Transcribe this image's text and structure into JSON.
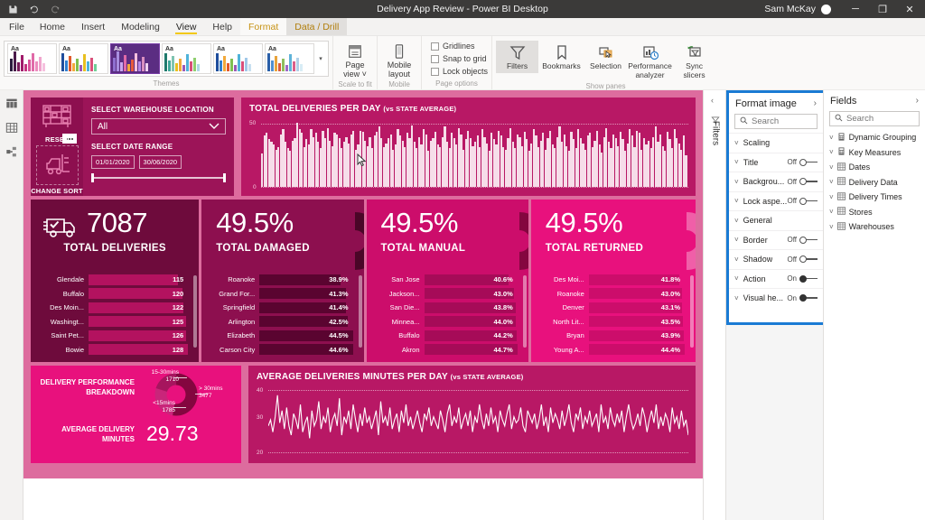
{
  "titlebar": {
    "save_icon": "save-icon",
    "undo_icon": "undo-icon",
    "redo_icon": "redo-icon",
    "title": "Delivery App Review - Power BI Desktop",
    "user": "Sam McKay",
    "minimize": "─",
    "restore": "❐",
    "close": "✕"
  },
  "ribbon_tabs": [
    {
      "label": "File",
      "state": "normal"
    },
    {
      "label": "Home",
      "state": "normal"
    },
    {
      "label": "Insert",
      "state": "normal"
    },
    {
      "label": "Modeling",
      "state": "normal"
    },
    {
      "label": "View",
      "state": "active"
    },
    {
      "label": "Help",
      "state": "normal"
    },
    {
      "label": "Format",
      "state": "contextual"
    },
    {
      "label": "Data / Drill",
      "state": "contextual-selected"
    }
  ],
  "ribbon": {
    "themes": {
      "group_label": "Themes",
      "swatch_text": "Aa",
      "selected_index": 2,
      "more_glyph": "▾"
    },
    "scale_to_fit": {
      "group_label": "Scale to fit",
      "button": {
        "line1": "Page",
        "line2": "view ˅",
        "icon": "page-view-icon"
      }
    },
    "mobile": {
      "group_label": "Mobile",
      "button": {
        "line1": "Mobile",
        "line2": "layout",
        "icon": "mobile-layout-icon"
      }
    },
    "page_options": {
      "group_label": "Page options",
      "checkboxes": [
        {
          "label": "Gridlines",
          "checked": false
        },
        {
          "label": "Snap to grid",
          "checked": false
        },
        {
          "label": "Lock objects",
          "checked": false
        }
      ]
    },
    "show_panes": {
      "group_label": "Show panes",
      "buttons": [
        {
          "line1": "Filters",
          "line2": "",
          "icon": "funnel-icon",
          "selected": true
        },
        {
          "line1": "Bookmarks",
          "line2": "",
          "icon": "bookmark-icon",
          "selected": false
        },
        {
          "line1": "Selection",
          "line2": "",
          "icon": "selection-icon",
          "selected": false
        },
        {
          "line1": "Performance",
          "line2": "analyzer",
          "icon": "performance-analyzer-icon",
          "selected": false
        },
        {
          "line1": "Sync",
          "line2": "slicers",
          "icon": "sync-slicers-icon",
          "selected": false
        }
      ]
    }
  },
  "left_rail": [
    {
      "name": "report-view-icon",
      "active": true
    },
    {
      "name": "data-view-icon",
      "active": false
    },
    {
      "name": "model-view-icon",
      "active": false
    }
  ],
  "report": {
    "controls": {
      "reset_label": "RESET",
      "change_sort_label": "CHANGE SORT",
      "warehouse_title": "SELECT WAREHOUSE LOCATION",
      "warehouse_value": "All",
      "date_title": "SELECT DATE RANGE",
      "date_start": "01/01/2020",
      "date_end": "30/06/2020"
    },
    "deliveries_chart": {
      "title": "TOTAL DELIVERIES PER DAY",
      "subtitle": "(vs STATE AVERAGE)",
      "y_max_label": "50",
      "y_min_label": "0"
    },
    "minutes_chart": {
      "title": "AVERAGE DELIVERIES MINUTES PER DAY",
      "subtitle": "(vs STATE AVERAGE)",
      "y_top_label": "40",
      "y_mid_label": "30",
      "y_bot_label": "20"
    },
    "kpis": [
      {
        "value": "7087",
        "label": "TOTAL DELIVERIES",
        "icon": "truck-check-icon",
        "has_gauge": false,
        "rows": [
          {
            "name": "Glendale",
            "value": "115",
            "pct": 90
          },
          {
            "name": "Buffalo",
            "value": "120",
            "pct": 94
          },
          {
            "name": "Des Moin...",
            "value": "122",
            "pct": 95
          },
          {
            "name": "Washingt...",
            "value": "125",
            "pct": 98
          },
          {
            "name": "Saint Pet...",
            "value": "126",
            "pct": 98
          },
          {
            "name": "Bowie",
            "value": "128",
            "pct": 100
          }
        ]
      },
      {
        "value": "49.5%",
        "label": "TOTAL DAMAGED",
        "has_gauge": true,
        "rows": [
          {
            "name": "Roanoke",
            "value": "38.9%",
            "pct": 87
          },
          {
            "name": "Grand For...",
            "value": "41.3%",
            "pct": 93
          },
          {
            "name": "Springfield",
            "value": "41.4%",
            "pct": 93
          },
          {
            "name": "Arlington",
            "value": "42.5%",
            "pct": 95
          },
          {
            "name": "Elizabeth",
            "value": "44.5%",
            "pct": 100
          },
          {
            "name": "Carson City",
            "value": "44.6%",
            "pct": 100
          }
        ]
      },
      {
        "value": "49.5%",
        "label": "TOTAL MANUAL",
        "has_gauge": true,
        "rows": [
          {
            "name": "San Jose",
            "value": "40.6%",
            "pct": 91
          },
          {
            "name": "Jackson...",
            "value": "43.0%",
            "pct": 96
          },
          {
            "name": "San Die...",
            "value": "43.8%",
            "pct": 98
          },
          {
            "name": "Minnea...",
            "value": "44.0%",
            "pct": 98
          },
          {
            "name": "Buffalo",
            "value": "44.2%",
            "pct": 99
          },
          {
            "name": "Akron",
            "value": "44.7%",
            "pct": 100
          }
        ]
      },
      {
        "value": "49.5%",
        "label": "TOTAL RETURNED",
        "has_gauge": true,
        "rows": [
          {
            "name": "Des Moi...",
            "value": "41.8%",
            "pct": 94
          },
          {
            "name": "Roanoke",
            "value": "43.0%",
            "pct": 97
          },
          {
            "name": "Denver",
            "value": "43.1%",
            "pct": 97
          },
          {
            "name": "North Lit...",
            "value": "43.5%",
            "pct": 98
          },
          {
            "name": "Bryan",
            "value": "43.9%",
            "pct": 99
          },
          {
            "name": "Young A...",
            "value": "44.4%",
            "pct": 100
          }
        ]
      }
    ],
    "performance": {
      "title_line1": "DELIVERY PERFORMANCE",
      "title_line2": "BREAKDOWN",
      "avg_label_line1": "AVERAGE DELIVERY",
      "avg_label_line2": "MINUTES",
      "avg_value": "29.73",
      "segments": [
        {
          "label": "15-30mins",
          "value": "1710"
        },
        {
          "label": "> 30mins",
          "value": "3477"
        },
        {
          "label": "<15mins",
          "value": "1785"
        }
      ]
    }
  },
  "filters_strip": {
    "label": "Filters",
    "collapse_glyph": "‹",
    "icon": "funnel-icon"
  },
  "format_pane": {
    "title": "Format image",
    "expand_glyph": "›",
    "search_placeholder": "Search",
    "rows": [
      {
        "name": "Scaling",
        "toggle": null
      },
      {
        "name": "Title",
        "toggle": "Off"
      },
      {
        "name": "Backgrou...",
        "toggle": "Off"
      },
      {
        "name": "Lock aspe...",
        "toggle": "Off"
      },
      {
        "name": "General",
        "toggle": null
      },
      {
        "name": "Border",
        "toggle": "Off"
      },
      {
        "name": "Shadow",
        "toggle": "Off"
      },
      {
        "name": "Action",
        "toggle": "On"
      },
      {
        "name": "Visual he...",
        "toggle": "On"
      }
    ]
  },
  "fields_pane": {
    "title": "Fields",
    "expand_glyph": "›",
    "search_placeholder": "Search",
    "items": [
      {
        "label": "Dynamic Grouping",
        "icon": "calculator-icon"
      },
      {
        "label": "Key Measures",
        "icon": "calculator-icon"
      },
      {
        "label": "Dates",
        "icon": "table-icon"
      },
      {
        "label": "Delivery Data",
        "icon": "table-icon"
      },
      {
        "label": "Delivery Times",
        "icon": "table-icon"
      },
      {
        "label": "Stores",
        "icon": "table-icon"
      },
      {
        "label": "Warehouses",
        "icon": "table-icon"
      }
    ]
  },
  "chart_data": [
    {
      "type": "bar",
      "title": "TOTAL DELIVERIES PER DAY (vs STATE AVERAGE)",
      "ylabel": "",
      "xlabel": "",
      "ylim": [
        0,
        50
      ],
      "tick_labels": [
        "0",
        "50"
      ],
      "grid": true,
      "series": [
        {
          "name": "Deliveries per day",
          "values": [
            26,
            40,
            42,
            37,
            35,
            33,
            29,
            31,
            41,
            45,
            35,
            30,
            28,
            36,
            38,
            50,
            45,
            42,
            31,
            37,
            33,
            45,
            39,
            42,
            35,
            30,
            44,
            38,
            46,
            36,
            32,
            42,
            41,
            38,
            30,
            35,
            39,
            34,
            41,
            44,
            29,
            33,
            44,
            43,
            36,
            32,
            39,
            30,
            40,
            43,
            47,
            38,
            31,
            34,
            38,
            41,
            29,
            33,
            45,
            40,
            36,
            31,
            42,
            38,
            48,
            35,
            30,
            39,
            33,
            45,
            41,
            28,
            36,
            38,
            43,
            33,
            31,
            39,
            47,
            35,
            30,
            42,
            38,
            33,
            46,
            41,
            29,
            37,
            44,
            38,
            32,
            35,
            40,
            31,
            45,
            39,
            34,
            28,
            42,
            37,
            33,
            44,
            40,
            31,
            29,
            38,
            46,
            35,
            30,
            41,
            39,
            32,
            43,
            37,
            28,
            34,
            45,
            40,
            31,
            36,
            42,
            29,
            38,
            44,
            33,
            30,
            39,
            47,
            35,
            41,
            32,
            28,
            43,
            37,
            30,
            45,
            38,
            34,
            29,
            40,
            42,
            31,
            36,
            44,
            33,
            27,
            39,
            46,
            35,
            30,
            41,
            38,
            32,
            43,
            37,
            28,
            34,
            45,
            40,
            31,
            44,
            42,
            29,
            38,
            33,
            36,
            30,
            39,
            47,
            35,
            41,
            32,
            28,
            43,
            37,
            30,
            45,
            38,
            34,
            29,
            40,
            25
          ]
        }
      ]
    },
    {
      "type": "line",
      "title": "AVERAGE DELIVERIES MINUTES PER DAY (vs STATE AVERAGE)",
      "ylim": [
        20,
        40
      ],
      "tick_labels": [
        "20",
        "30",
        "40"
      ],
      "grid": true,
      "series": [
        {
          "name": "Average minutes",
          "values": [
            28,
            30,
            26,
            31,
            38,
            29,
            33,
            27,
            34,
            28,
            25,
            32,
            30,
            27,
            35,
            26,
            29,
            31,
            24,
            33,
            28,
            30,
            36,
            27,
            31,
            29,
            34,
            26,
            30,
            32,
            28,
            37,
            25,
            31,
            29,
            33,
            27,
            35,
            30,
            26,
            32,
            28,
            34,
            29,
            31,
            27,
            30,
            33,
            25,
            36,
            29,
            31,
            28,
            34,
            27,
            30,
            32,
            26,
            33,
            29,
            35,
            28,
            31,
            27,
            30,
            33,
            29,
            26,
            32,
            30,
            34,
            28,
            31,
            29,
            27,
            33,
            30,
            26,
            32,
            35,
            28,
            31,
            29,
            34,
            27,
            30,
            32,
            28,
            33,
            26,
            31,
            29,
            35,
            30,
            27,
            32,
            28,
            34,
            29,
            31,
            26,
            33,
            30,
            28,
            32,
            35,
            27,
            31,
            29,
            30,
            34,
            28,
            26,
            33,
            31,
            29,
            32,
            27,
            30,
            35,
            28,
            31,
            26,
            34,
            29,
            32,
            30,
            27,
            33,
            28,
            31,
            35,
            29,
            26,
            32,
            30,
            34,
            27,
            31,
            29,
            33,
            28,
            30,
            32,
            26,
            35,
            29,
            31,
            27,
            34,
            30,
            28,
            32,
            29,
            33,
            26,
            31,
            35,
            30,
            27,
            29,
            32,
            28,
            34,
            31,
            26,
            30,
            33,
            29,
            35,
            27,
            31,
            28,
            32,
            30,
            26,
            34,
            29,
            31,
            27,
            33,
            28,
            30,
            25
          ]
        }
      ]
    },
    {
      "type": "pie",
      "title": "DELIVERY PERFORMANCE BREAKDOWN",
      "labels": [
        "15-30mins",
        "> 30mins",
        "<15mins"
      ],
      "values": [
        1710,
        3477,
        1785
      ]
    }
  ]
}
